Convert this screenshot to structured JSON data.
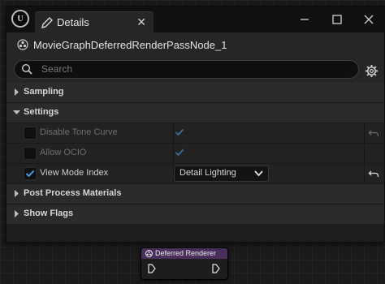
{
  "titlebar": {
    "logo_text": "U",
    "tab_label": "Details",
    "tab_icon": "pencil-icon",
    "close_glyph": "✕"
  },
  "object": {
    "name": "MovieGraphDeferredRenderPassNode_1",
    "icon": "node-icon"
  },
  "search": {
    "placeholder": "Search",
    "settings_icon": "gear-icon"
  },
  "sections": {
    "sampling": "Sampling",
    "settings": "Settings",
    "post_process": "Post Process Materials",
    "show_flags": "Show Flags"
  },
  "properties": [
    {
      "label": "Disable Tone Curve",
      "override_checked": false,
      "value_checked": true,
      "enabled": false
    },
    {
      "label": "Allow OCIO",
      "override_checked": false,
      "value_checked": true,
      "enabled": false
    },
    {
      "label": "View Mode Index",
      "override_checked": true,
      "value": "Detail Lighting",
      "enabled": true
    }
  ],
  "graph_node": {
    "title": "Deferred Renderer",
    "color": "#4a2f5c"
  },
  "colors": {
    "accent": "#4aa3ff",
    "panel": "#1e1e1e",
    "section": "#2b2b2b"
  }
}
